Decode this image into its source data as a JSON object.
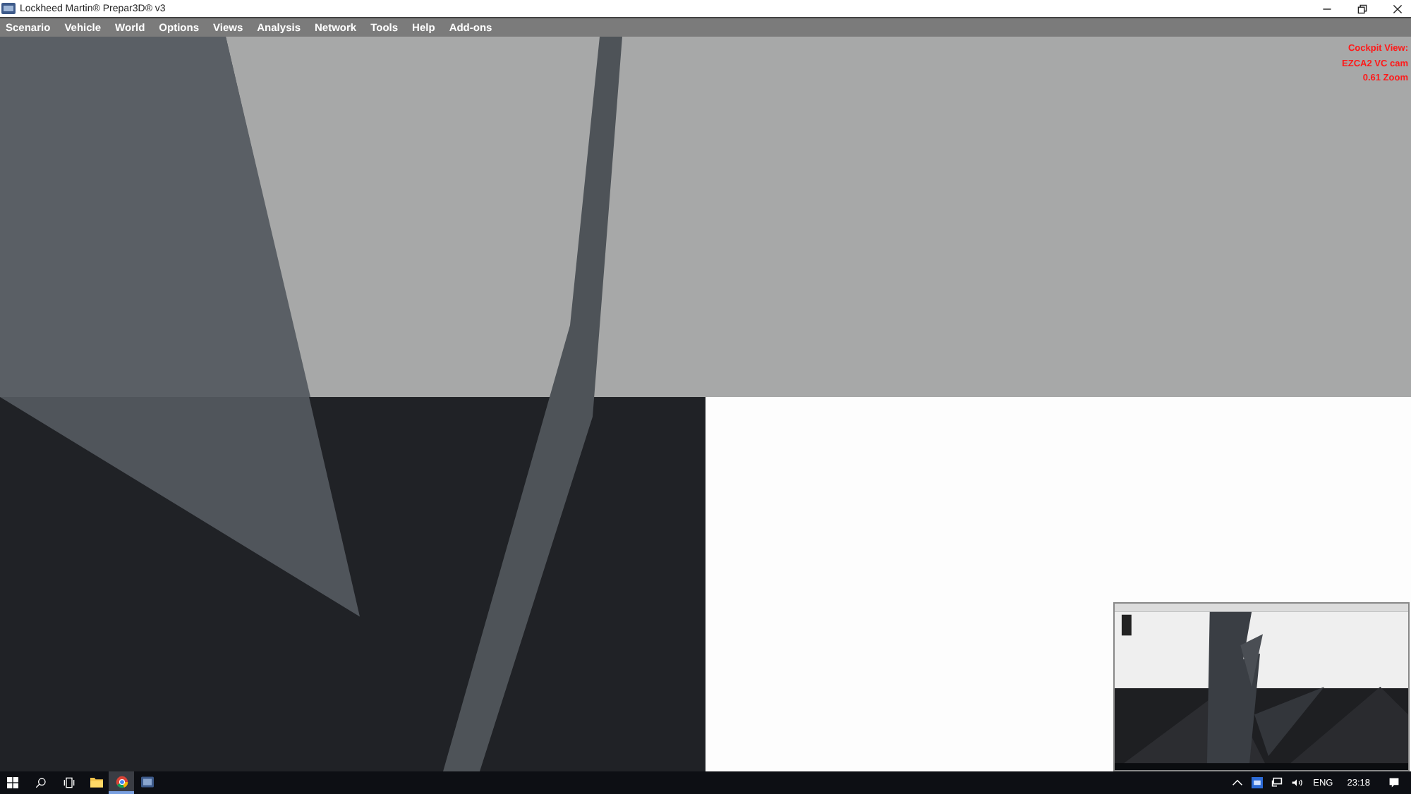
{
  "window": {
    "title": "Lockheed Martin® Prepar3D® v3"
  },
  "menu": [
    "Scenario",
    "Vehicle",
    "World",
    "Options",
    "Views",
    "Analysis",
    "Network",
    "Tools",
    "Help",
    "Add-ons"
  ],
  "overlay": [
    "Cockpit View:",
    "EZCA2 VC cam",
    "0.61 Zoom"
  ],
  "taskbar": {
    "apps": [
      {
        "kind": "explorer",
        "selected": false
      },
      {
        "kind": "browser",
        "selected": true
      },
      {
        "kind": "sim",
        "selected": false
      }
    ],
    "language": "ENG",
    "clock": "23:18"
  }
}
